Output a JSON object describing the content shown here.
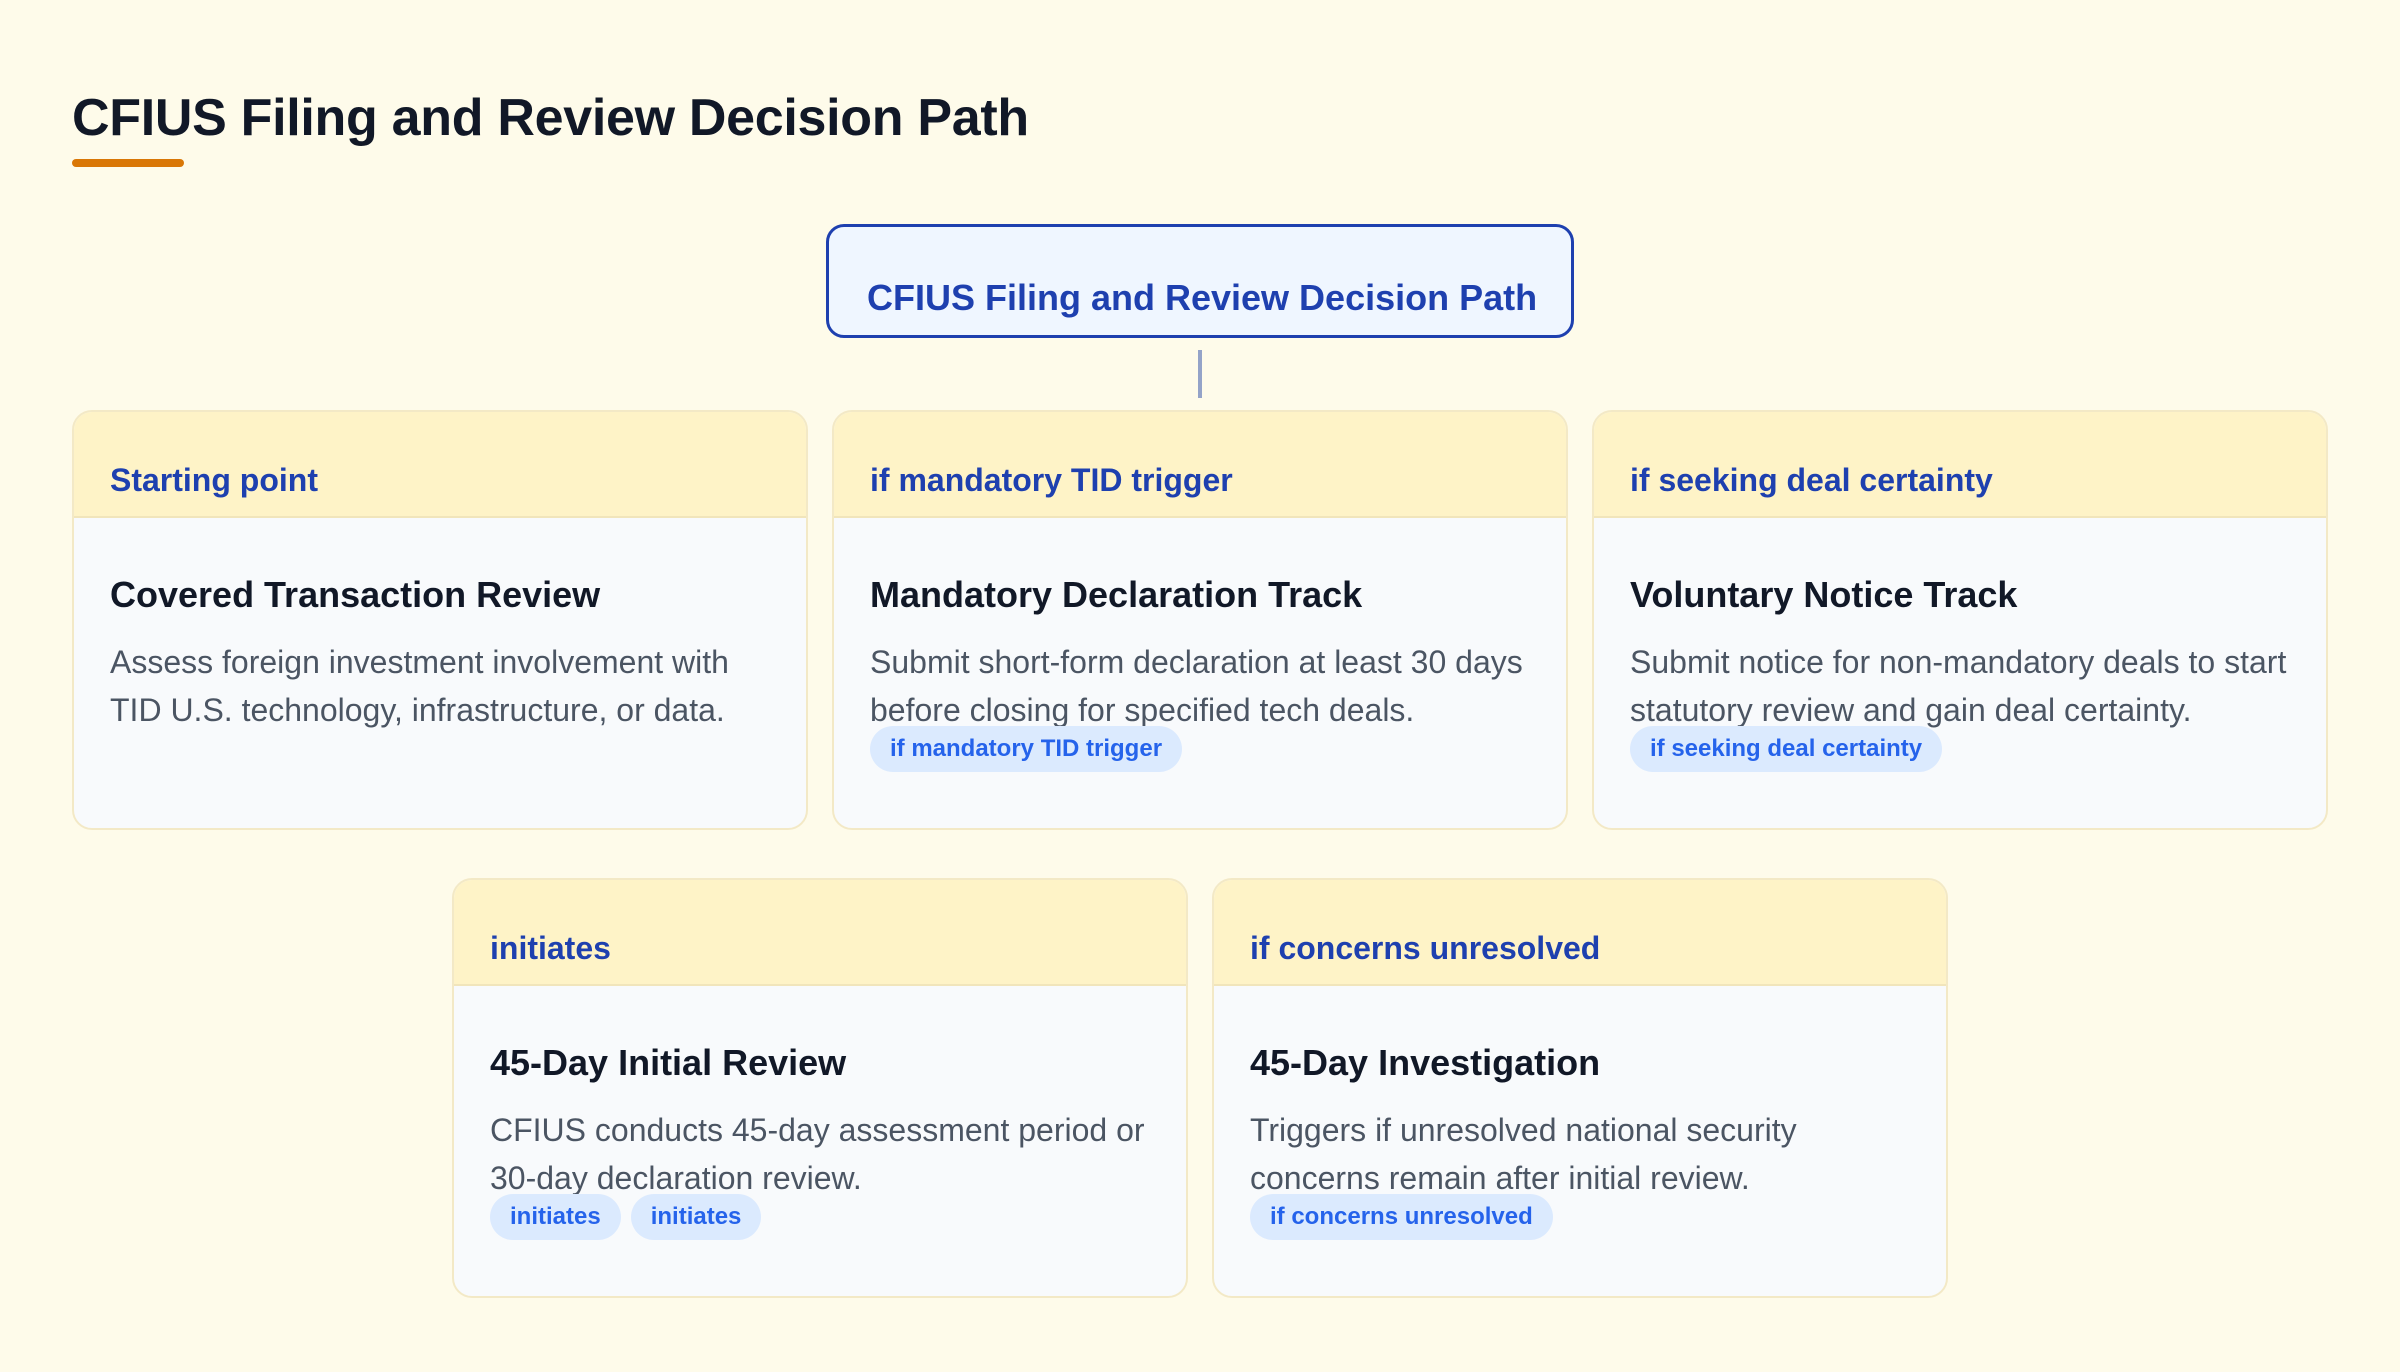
{
  "page": {
    "title": "CFIUS Filing and Review Decision Path"
  },
  "root": {
    "label": "CFIUS Filing and Review Decision Path"
  },
  "cards": [
    {
      "tag": "Starting point",
      "title": "Covered Transaction Review",
      "description": "Assess foreign investment involvement with TID U.S. technology, infrastructure, or data.",
      "chips": []
    },
    {
      "tag": "if mandatory TID trigger",
      "title": "Mandatory Declaration Track",
      "description": "Submit short-form declaration at least 30 days before closing for specified tech deals.",
      "chips": [
        "if mandatory TID trigger"
      ]
    },
    {
      "tag": "if seeking deal certainty",
      "title": "Voluntary Notice Track",
      "description": "Submit notice for non-mandatory deals to start statutory review and gain deal certainty.",
      "chips": [
        "if seeking deal certainty"
      ]
    },
    {
      "tag": "initiates",
      "title": "45-Day Initial Review",
      "description": "CFIUS conducts 45-day assessment period or 30-day declaration review.",
      "chips": [
        "initiates",
        "initiates"
      ]
    },
    {
      "tag": "if concerns unresolved",
      "title": "45-Day Investigation",
      "description": "Triggers if unresolved national security concerns remain after initial review.",
      "chips": [
        "if concerns unresolved"
      ]
    }
  ],
  "colors": {
    "background": "#fefbea",
    "accent": "#d97706",
    "primary": "#1e40af",
    "card_header": "#fef3c7",
    "chip_bg": "#dbeafe",
    "chip_text": "#2563eb"
  }
}
